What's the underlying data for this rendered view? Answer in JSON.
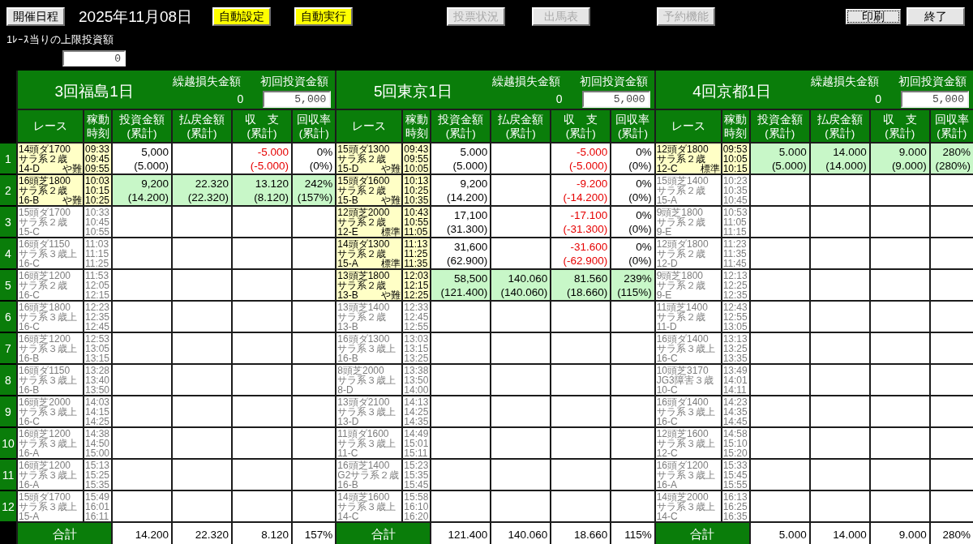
{
  "toolbar": {
    "schedule_button": "開催日程",
    "date": "2025年11月08日",
    "buttons": [
      {
        "label": "自動設定",
        "kind": "highlight",
        "disabled": false,
        "focused": false
      },
      {
        "label": "自動実行",
        "kind": "highlight",
        "disabled": false,
        "focused": false
      },
      {
        "label": "投票状況",
        "kind": "plain",
        "disabled": true,
        "focused": false
      },
      {
        "label": "出馬表",
        "kind": "plain",
        "disabled": true,
        "focused": false
      },
      {
        "label": "予約機能",
        "kind": "plain",
        "disabled": true,
        "focused": false
      },
      {
        "label": "印刷",
        "kind": "plain",
        "disabled": false,
        "focused": true
      },
      {
        "label": "終了",
        "kind": "plain",
        "disabled": false,
        "focused": false
      }
    ]
  },
  "race_limit": {
    "label": "1ﾚｰｽ当りの上限投資額",
    "value": "0"
  },
  "table": {
    "row_numbers": [
      "1",
      "2",
      "3",
      "4",
      "5",
      "6",
      "7",
      "8",
      "9",
      "10",
      "11",
      "12"
    ],
    "venues": [
      {
        "name": "3回福島1日",
        "carryover": {
          "label": "繰越損失金額",
          "value": "0"
        },
        "initial_investment": {
          "label": "初回投資金額",
          "value": "5,000"
        },
        "columns": [
          "レース",
          "稼動時刻",
          "投資金額\n(累計)",
          "払戻金額\n(累計)",
          "収　支\n(累計)",
          "回収率\n(累計)"
        ],
        "rows": [
          {
            "race": {
              "summary": "14頭ダ1700",
              "class": "サラ系２歳",
              "code": "14-D",
              "condition": "や難"
            },
            "times": [
              "09:33",
              "09:45",
              "09:55"
            ],
            "bet": true,
            "hit": false,
            "result": {
              "invest": {
                "value": "5,000",
                "total": "(5.000)"
              },
              "balance": {
                "value": "-5.000",
                "total": "(-5.000)",
                "negative": true
              },
              "rate": {
                "value": "0%",
                "total": "(0%)"
              }
            }
          },
          {
            "race": {
              "summary": "16頭芝1800",
              "class": "サラ系２歳",
              "code": "16-B",
              "condition": "や難"
            },
            "times": [
              "10:03",
              "10:15",
              "10:25"
            ],
            "bet": true,
            "hit": true,
            "result": {
              "invest": {
                "value": "9,200",
                "total": "(14.200)"
              },
              "payout": {
                "value": "22.320",
                "total": "(22.320)"
              },
              "balance": {
                "value": "13.120",
                "total": "(8.120)",
                "negative": false
              },
              "rate": {
                "value": "242%",
                "total": "(157%)"
              }
            }
          },
          {
            "race": {
              "summary": "15頭ダ1700",
              "class": "サラ系２歳",
              "code": "15-C"
            },
            "times": [
              "10:33",
              "10:45",
              "10:55"
            ],
            "bet": false,
            "hit": false
          },
          {
            "race": {
              "summary": "16頭ダ1150",
              "class": "サラ系３歳上",
              "code": "16-C"
            },
            "times": [
              "11:03",
              "11:15",
              "11:25"
            ],
            "bet": false,
            "hit": false
          },
          {
            "race": {
              "summary": "16頭芝1200",
              "class": "サラ系２歳",
              "code": "16-C"
            },
            "times": [
              "11:53",
              "12:05",
              "12:15"
            ],
            "bet": false,
            "hit": false
          },
          {
            "race": {
              "summary": "16頭芝1800",
              "class": "サラ系３歳上",
              "code": "16-C"
            },
            "times": [
              "12:23",
              "12:35",
              "12:45"
            ],
            "bet": false,
            "hit": false
          },
          {
            "race": {
              "summary": "16頭芝1200",
              "class": "サラ系３歳上",
              "code": "16-B"
            },
            "times": [
              "12:53",
              "13:05",
              "13:15"
            ],
            "bet": false,
            "hit": false
          },
          {
            "race": {
              "summary": "16頭ダ1150",
              "class": "サラ系３歳上",
              "code": "16-B"
            },
            "times": [
              "13:28",
              "13:40",
              "13:50"
            ],
            "bet": false,
            "hit": false
          },
          {
            "race": {
              "summary": "16頭芝2000",
              "class": "サラ系３歳上",
              "code": "16-C"
            },
            "times": [
              "14:03",
              "14:15",
              "14:25"
            ],
            "bet": false,
            "hit": false
          },
          {
            "race": {
              "summary": "16頭芝1200",
              "class": "サラ系３歳上",
              "code": "16-A"
            },
            "times": [
              "14:38",
              "14:50",
              "15:00"
            ],
            "bet": false,
            "hit": false
          },
          {
            "race": {
              "summary": "16頭芝1200",
              "class": "サラ系３歳上",
              "code": "16-A"
            },
            "times": [
              "15:13",
              "15:25",
              "15:35"
            ],
            "bet": false,
            "hit": false
          },
          {
            "race": {
              "summary": "15頭ダ1700",
              "class": "サラ系３歳上",
              "code": "15-A"
            },
            "times": [
              "15:49",
              "16:01",
              "16:11"
            ],
            "bet": false,
            "hit": false
          }
        ],
        "totals": {
          "label": "合計",
          "values": [
            "14.200",
            "22.320",
            "8.120",
            "157%"
          ]
        }
      },
      {
        "name": "5回東京1日",
        "carryover": {
          "label": "繰越損失金額",
          "value": "0"
        },
        "initial_investment": {
          "label": "初回投資金額",
          "value": "5,000"
        },
        "columns": [
          "レース",
          "稼動時刻",
          "投資金額\n(累計)",
          "払戻金額\n(累計)",
          "収　支\n(累計)",
          "回収率\n(累計)"
        ],
        "rows": [
          {
            "race": {
              "summary": "15頭ダ1300",
              "class": "サラ系２歳",
              "code": "15-D",
              "condition": "や難"
            },
            "times": [
              "09:43",
              "09:55",
              "10:05"
            ],
            "bet": true,
            "hit": false,
            "result": {
              "invest": {
                "value": "5.000",
                "total": "(5.000)"
              },
              "balance": {
                "value": "-5.000",
                "total": "(-5.000)",
                "negative": true
              },
              "rate": {
                "value": "0%",
                "total": "(0%)"
              }
            }
          },
          {
            "race": {
              "summary": "15頭ダ1600",
              "class": "サラ系２歳",
              "code": "15-B",
              "condition": "や難"
            },
            "times": [
              "10:13",
              "10:25",
              "10:35"
            ],
            "bet": true,
            "hit": false,
            "result": {
              "invest": {
                "value": "9,200",
                "total": "(14.200)"
              },
              "balance": {
                "value": "-9.200",
                "total": "(-14.200)",
                "negative": true
              },
              "rate": {
                "value": "0%",
                "total": "(0%)"
              }
            }
          },
          {
            "race": {
              "summary": "12頭芝2000",
              "class": "サラ系２歳",
              "code": "12-E",
              "condition": "標準"
            },
            "times": [
              "10:43",
              "10:55",
              "11:05"
            ],
            "bet": true,
            "hit": false,
            "result": {
              "invest": {
                "value": "17,100",
                "total": "(31.300)"
              },
              "balance": {
                "value": "-17.100",
                "total": "(-31.300)",
                "negative": true
              },
              "rate": {
                "value": "0%",
                "total": "(0%)"
              }
            }
          },
          {
            "race": {
              "summary": "14頭ダ1300",
              "class": "サラ系２歳",
              "code": "15-A",
              "condition": "標準"
            },
            "times": [
              "11:13",
              "11:25",
              "11:35"
            ],
            "bet": true,
            "hit": false,
            "result": {
              "invest": {
                "value": "31,600",
                "total": "(62.900)"
              },
              "balance": {
                "value": "-31.600",
                "total": "(-62.900)",
                "negative": true
              },
              "rate": {
                "value": "0%",
                "total": "(0%)"
              }
            }
          },
          {
            "race": {
              "summary": "13頭芝1800",
              "class": "サラ系２歳",
              "code": "13-B",
              "condition": "や難"
            },
            "times": [
              "12:03",
              "12:15",
              "12:25"
            ],
            "bet": true,
            "hit": true,
            "result": {
              "invest": {
                "value": "58,500",
                "total": "(121.400)"
              },
              "payout": {
                "value": "140.060",
                "total": "(140.060)"
              },
              "balance": {
                "value": "81.560",
                "total": "(18.660)",
                "negative": false
              },
              "rate": {
                "value": "239%",
                "total": "(115%)"
              }
            }
          },
          {
            "race": {
              "summary": "13頭芝1400",
              "class": "サラ系２歳",
              "code": "13-B"
            },
            "times": [
              "12:33",
              "12:45",
              "12:55"
            ],
            "bet": false,
            "hit": false
          },
          {
            "race": {
              "summary": "16頭ダ1300",
              "class": "サラ系３歳上",
              "code": "16-B"
            },
            "times": [
              "13:03",
              "13:15",
              "13:25"
            ],
            "bet": false,
            "hit": false
          },
          {
            "race": {
              "summary": "8頭芝2000",
              "class": "サラ系３歳上",
              "code": "8-D"
            },
            "times": [
              "13:38",
              "13:50",
              "14:00"
            ],
            "bet": false,
            "hit": false
          },
          {
            "race": {
              "summary": "13頭ダ2100",
              "class": "サラ系３歳上",
              "code": "13-D"
            },
            "times": [
              "14:13",
              "14:25",
              "14:35"
            ],
            "bet": false,
            "hit": false
          },
          {
            "race": {
              "summary": "11頭ダ1600",
              "class": "サラ系３歳上",
              "code": "11-C"
            },
            "times": [
              "14:49",
              "15:01",
              "15:11"
            ],
            "bet": false,
            "hit": false
          },
          {
            "race": {
              "summary": "16頭芝1400",
              "class": "G2サラ系２歳",
              "code": "16-B"
            },
            "times": [
              "15:23",
              "15:35",
              "15:45"
            ],
            "bet": false,
            "hit": false
          },
          {
            "race": {
              "summary": "14頭芝1600",
              "class": "サラ系３歳上",
              "code": "14-C"
            },
            "times": [
              "15:58",
              "16:10",
              "16:20"
            ],
            "bet": false,
            "hit": false
          }
        ],
        "totals": {
          "label": "合計",
          "values": [
            "121.400",
            "140.060",
            "18.660",
            "115%"
          ]
        }
      },
      {
        "name": "4回京都1日",
        "carryover": {
          "label": "繰越損失金額",
          "value": "0"
        },
        "initial_investment": {
          "label": "初回投資金額",
          "value": "5,000"
        },
        "columns": [
          "レース",
          "稼動時刻",
          "投資金額\n(累計)",
          "払戻金額\n(累計)",
          "収　支\n(累計)",
          "回収率\n(累計)"
        ],
        "rows": [
          {
            "race": {
              "summary": "12頭ダ1800",
              "class": "サラ系２歳",
              "code": "12-C",
              "condition": "標準"
            },
            "times": [
              "09:53",
              "10:05",
              "10:15"
            ],
            "bet": true,
            "hit": true,
            "result": {
              "invest": {
                "value": "5.000",
                "total": "(5.000)"
              },
              "payout": {
                "value": "14.000",
                "total": "(14.000)"
              },
              "balance": {
                "value": "9.000",
                "total": "(9.000)",
                "negative": false
              },
              "rate": {
                "value": "280%",
                "total": "(280%)"
              }
            }
          },
          {
            "race": {
              "summary": "15頭芝1400",
              "class": "サラ系２歳",
              "code": "15-A"
            },
            "times": [
              "10:23",
              "10:35",
              "10:45"
            ],
            "bet": false,
            "hit": false
          },
          {
            "race": {
              "summary": "9頭芝1800",
              "class": "サラ系２歳",
              "code": "9-E"
            },
            "times": [
              "10:53",
              "11:05",
              "11:15"
            ],
            "bet": false,
            "hit": false
          },
          {
            "race": {
              "summary": "12頭ダ1800",
              "class": "サラ系２歳",
              "code": "12-D"
            },
            "times": [
              "11:23",
              "11:35",
              "11:45"
            ],
            "bet": false,
            "hit": false
          },
          {
            "race": {
              "summary": "9頭芝1800",
              "class": "サラ系２歳",
              "code": "9-E"
            },
            "times": [
              "12:13",
              "12:25",
              "12:35"
            ],
            "bet": false,
            "hit": false
          },
          {
            "race": {
              "summary": "11頭芝1400",
              "class": "サラ系２歳",
              "code": "11-D"
            },
            "times": [
              "12:43",
              "12:55",
              "13:05"
            ],
            "bet": false,
            "hit": false
          },
          {
            "race": {
              "summary": "16頭ダ1400",
              "class": "サラ系３歳上",
              "code": "16-C"
            },
            "times": [
              "13:13",
              "13:25",
              "13:35"
            ],
            "bet": false,
            "hit": false
          },
          {
            "race": {
              "summary": "10頭芝3170",
              "class": "JG3障害３歳",
              "code": "10-C"
            },
            "times": [
              "13:49",
              "14:01",
              "14:11"
            ],
            "bet": false,
            "hit": false
          },
          {
            "race": {
              "summary": "16頭ダ1400",
              "class": "サラ系３歳上",
              "code": "16-C"
            },
            "times": [
              "14:23",
              "14:35",
              "14:45"
            ],
            "bet": false,
            "hit": false
          },
          {
            "race": {
              "summary": "12頭芝1600",
              "class": "サラ系３歳上",
              "code": "12-C"
            },
            "times": [
              "14:58",
              "15:10",
              "15:20"
            ],
            "bet": false,
            "hit": false
          },
          {
            "race": {
              "summary": "16頭ダ1200",
              "class": "サラ系３歳上",
              "code": "16-A"
            },
            "times": [
              "15:33",
              "15:45",
              "15:55"
            ],
            "bet": false,
            "hit": false
          },
          {
            "race": {
              "summary": "14頭芝2000",
              "class": "サラ系３歳上",
              "code": "14-C"
            },
            "times": [
              "16:13",
              "16:25",
              "16:35"
            ],
            "bet": false,
            "hit": false
          }
        ],
        "totals": {
          "label": "合計",
          "values": [
            "5.000",
            "14.000",
            "9.000",
            "280%"
          ]
        }
      }
    ]
  }
}
